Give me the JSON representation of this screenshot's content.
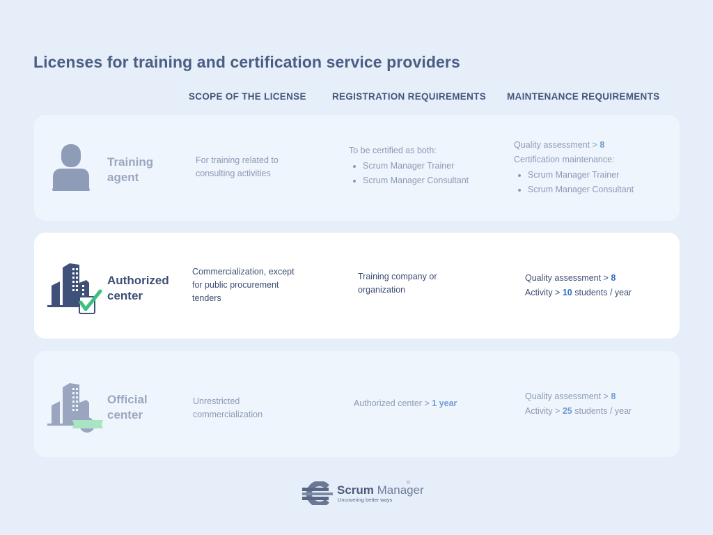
{
  "title": "Licenses for training and certification service providers",
  "columns": {
    "scope": "SCOPE OF THE LICENSE",
    "registration": "REGISTRATION REQUIREMENTS",
    "maintenance": "MAINTENANCE REQUIREMENTS"
  },
  "colors": {
    "page_background": "#e6eef9",
    "muted_card": "#eff5fc",
    "active_card": "#ffffff",
    "highlight_blue": "#2f6ccc",
    "check_green": "#3cc080"
  },
  "licenses": [
    {
      "name_line1": "Training",
      "name_line2": "agent",
      "icon": "person-icon",
      "scope_line1": "For training related to",
      "scope_line2": "consulting activities",
      "registration": {
        "intro": "To be certified as both:",
        "items": [
          "Scrum Manager Trainer",
          "Scrum Manager Consultant"
        ]
      },
      "maintenance": {
        "quality_label": "Quality assessment > ",
        "quality_value": "8",
        "cert_label": "Certification maintenance:",
        "items": [
          "Scrum Manager Trainer",
          "Scrum Manager Consultant"
        ]
      }
    },
    {
      "name_line1": "Authorized",
      "name_line2": "center",
      "icon": "building-check-icon",
      "scope_line1": "Commercialization, except",
      "scope_line2": "for public procurement",
      "scope_line3": "tenders",
      "registration_line1": "Training company or",
      "registration_line2": "organization",
      "maintenance": {
        "quality_label": "Quality assessment > ",
        "quality_value": "8",
        "activity_label": "Activity > ",
        "activity_value": "10",
        "activity_suffix": " students / year"
      }
    },
    {
      "name_line1": "Official",
      "name_line2": "center",
      "icon": "building-seal-icon",
      "scope_line1": "Unrestricted",
      "scope_line2": "commercialization",
      "registration_label": "Authorized center > ",
      "registration_value": "1 year",
      "maintenance": {
        "quality_label": "Quality assessment > ",
        "quality_value": "8",
        "activity_label": "Activity > ",
        "activity_value": "25",
        "activity_suffix": " students / year"
      }
    }
  ],
  "logo": {
    "word1": "Scrum",
    "word2": " Manager",
    "registered": "®",
    "tagline": "Uncovering better ways"
  }
}
